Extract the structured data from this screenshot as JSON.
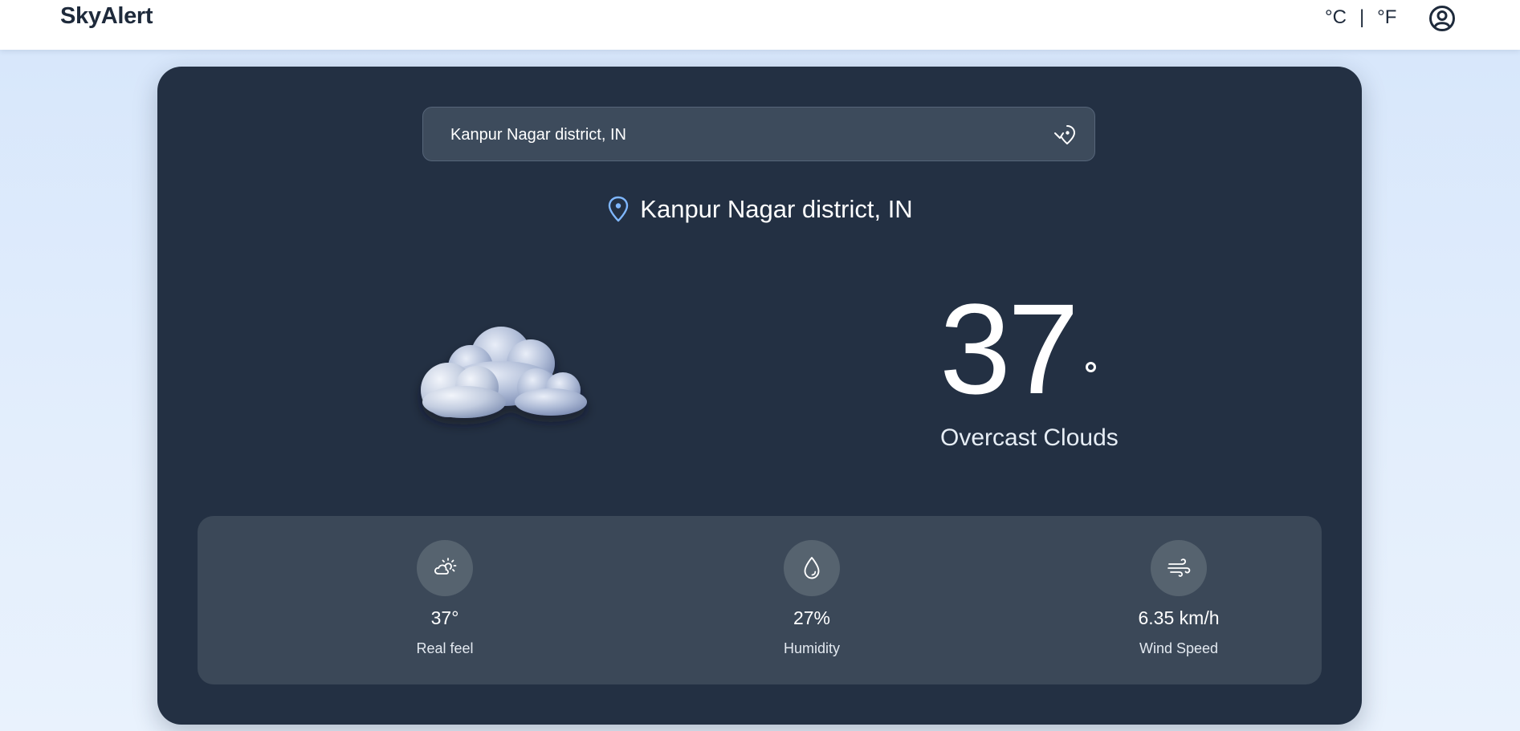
{
  "header": {
    "brand": "SkyAlert",
    "units": {
      "celsius": "°C",
      "separator": "|",
      "fahrenheit": "°F"
    }
  },
  "search": {
    "value": "Kanpur Nagar district, IN"
  },
  "current": {
    "location": "Kanpur Nagar district, IN",
    "temperature": "37",
    "condition": "Overcast Clouds",
    "icon": "cloud-icon"
  },
  "stats": [
    {
      "icon": "sun-cloud-icon",
      "value": "37°",
      "label": "Real feel"
    },
    {
      "icon": "water-drop-icon",
      "value": "27%",
      "label": "Humidity"
    },
    {
      "icon": "wind-icon",
      "value": "6.35 km/h",
      "label": "Wind Speed"
    }
  ],
  "colors": {
    "card": "#233043",
    "panel": "#3b4858",
    "accent": "#7fb7ff"
  }
}
